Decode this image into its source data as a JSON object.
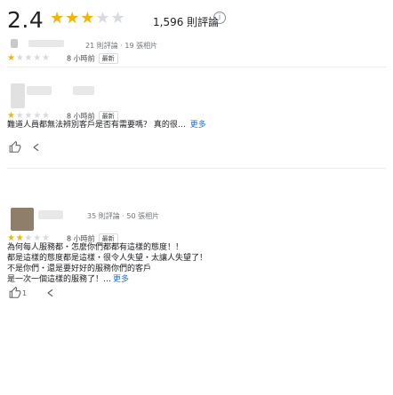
{
  "summary": {
    "rating": "2.4",
    "stars": {
      "filled": "★★",
      "half": "★",
      "empty": "★★"
    },
    "count": "1,596 則評論",
    "info_icon": "info-icon"
  },
  "reviews": [
    {
      "meta": "21 則評論 · 19 張相片",
      "stars": {
        "filled": "★",
        "empty": "★★★★"
      },
      "time": "8 小時前",
      "badge": "最新",
      "text": "",
      "more": "",
      "likes": ""
    },
    {
      "meta": "",
      "stars": {
        "filled": "★",
        "empty": "★★★★"
      },
      "time": "8 小時前",
      "badge": "最新",
      "text": "難道人員都無法辨別客戶是否有需要嗎？ 真的很…",
      "more": "更多",
      "likes": ""
    },
    {
      "meta": "35 則評論 · 50 張相片",
      "stars": {
        "filled": "★★",
        "empty": "★★★"
      },
      "time": "8 小時前",
      "badge": "最新",
      "text_line_1": "為何每人服務都・怎麼你們都都有這樣的態度！！",
      "text_line_2": "都是這樣的態度都是這樣・很令人失望・太讓人失望了！",
      "text_line_3": "不是你們・還是要好好的服務你們的客戶",
      "text_line_4": "是一次一個這樣的服務了！…",
      "more": "更多",
      "likes": "1"
    }
  ],
  "colors": {
    "star": "#f4b400",
    "empty_star": "#d7dbe0",
    "link": "#1a73e8"
  }
}
